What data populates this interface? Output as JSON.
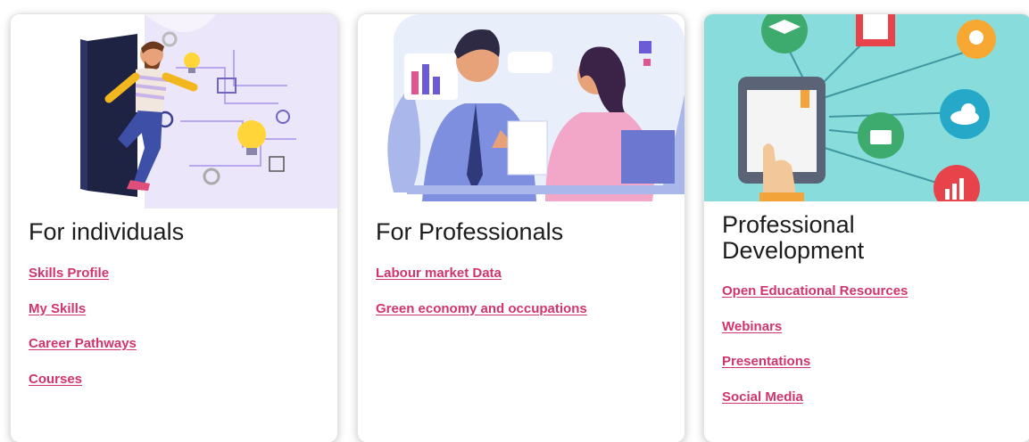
{
  "colors": {
    "link": "#d1346d",
    "title": "#1c1c1c",
    "card_border": "#e4e4e4"
  },
  "cards": [
    {
      "title": "For individuals",
      "illustration": "person-running-through-door-with-ideas",
      "links": [
        "Skills Profile",
        "My Skills",
        "Career Pathways ",
        "Courses"
      ]
    },
    {
      "title": "For Professionals",
      "illustration": "two-professionals-shaking-hands",
      "links": [
        "Labour market Data",
        "Green economy and occupations"
      ]
    },
    {
      "title": "Professional Development",
      "title_lines": [
        "Professional",
        "Development"
      ],
      "illustration": "tablet-connected-to-education-icons",
      "links": [
        "Open Educational Resources",
        "Webinars",
        "Presentations",
        "Social Media"
      ]
    }
  ]
}
